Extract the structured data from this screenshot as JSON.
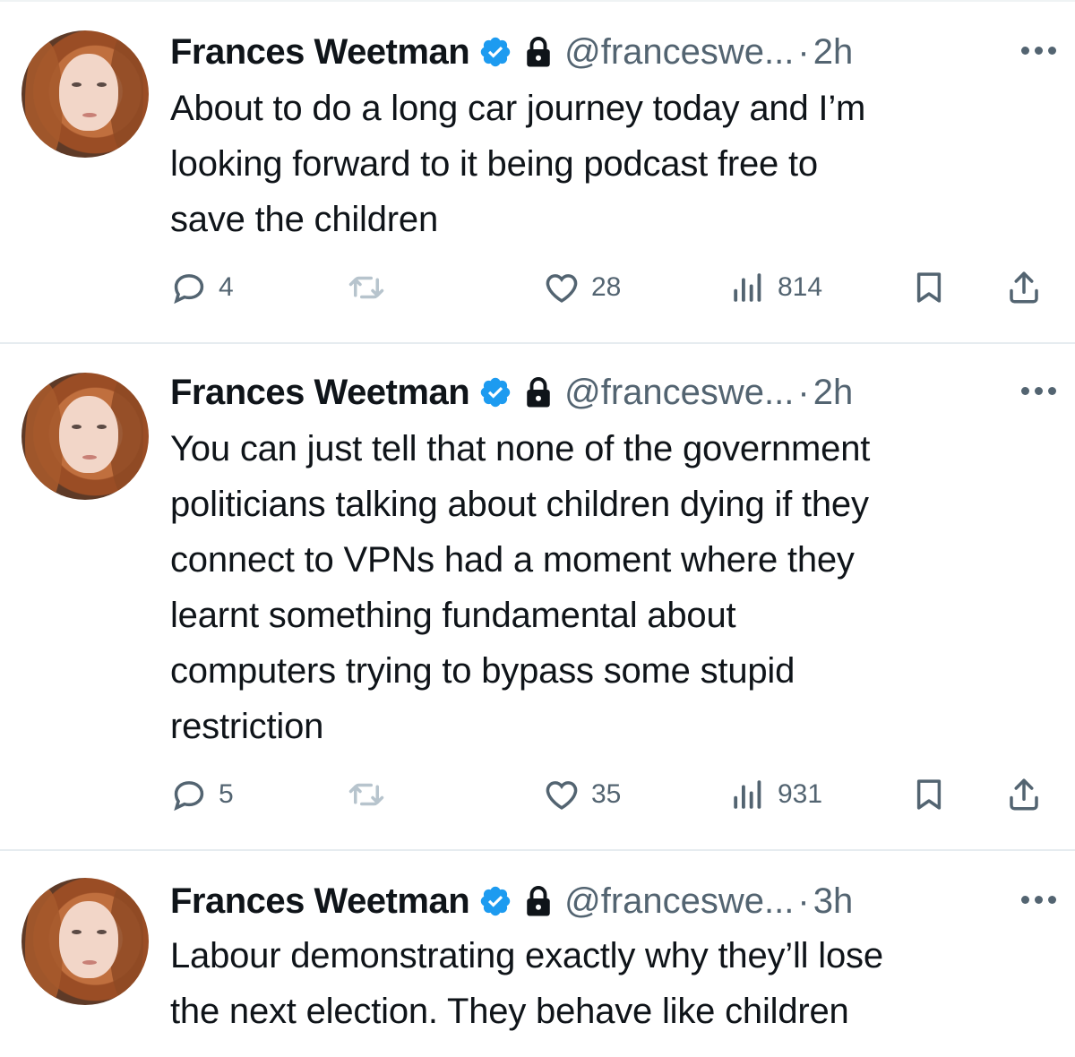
{
  "colors": {
    "text": "#0f1419",
    "secondary": "#536471",
    "verified": "#1d9bf0",
    "divider": "#e6ecf0"
  },
  "tweets": [
    {
      "name": "Frances Weetman",
      "handle": "@franceswe...",
      "separator": "·",
      "time": "2h",
      "lines": [
        "About to do a long car journey today and I’m",
        "looking forward to it being podcast free to",
        "save the children"
      ],
      "replies": "4",
      "retweets": "",
      "likes": "28",
      "views": "814"
    },
    {
      "name": "Frances Weetman",
      "handle": "@franceswe...",
      "separator": "·",
      "time": "2h",
      "lines": [
        "You can just tell that none of the government",
        "politicians talking about children dying if they",
        "connect to VPNs had a moment where they",
        "learnt something fundamental about",
        "computers trying to bypass some stupid",
        "restriction"
      ],
      "replies": "5",
      "retweets": "",
      "likes": "35",
      "views": "931"
    },
    {
      "name": "Frances Weetman",
      "handle": "@franceswe...",
      "separator": "·",
      "time": "3h",
      "lines": [
        "Labour demonstrating exactly why they’ll lose",
        "the next election. They behave like children"
      ]
    }
  ],
  "icons": {
    "verified": "verified-badge-icon",
    "lock": "lock-icon",
    "more": "more-options-icon",
    "reply": "reply-icon",
    "retweet": "retweet-icon",
    "like": "heart-icon",
    "views": "views-icon",
    "bookmark": "bookmark-icon",
    "share": "share-icon"
  }
}
